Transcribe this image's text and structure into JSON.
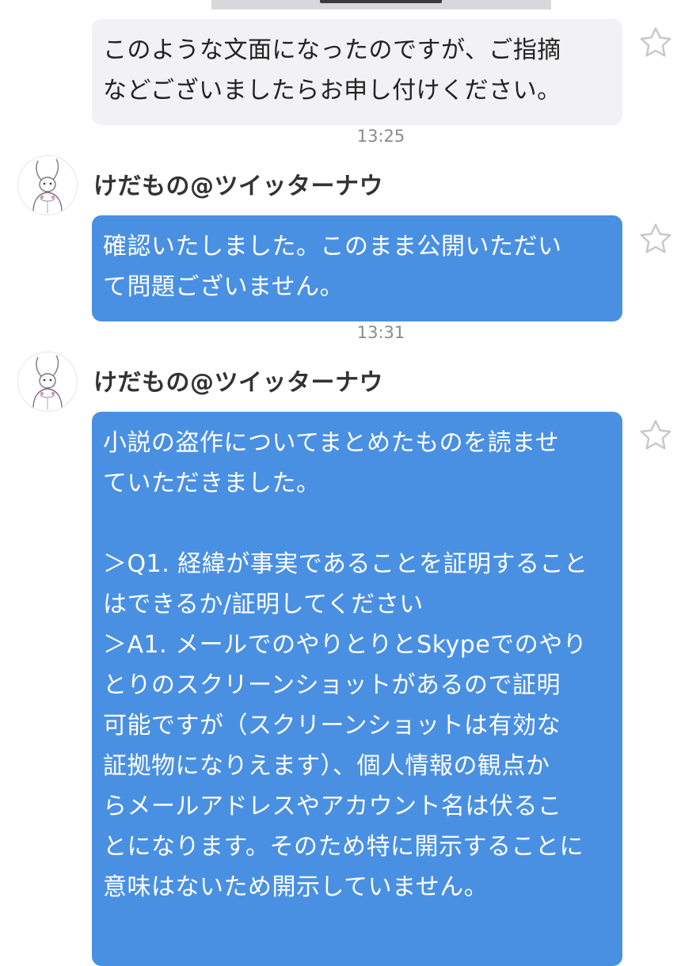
{
  "messages": [
    {
      "text": "このような文面になったのですが、ご指摘\nなどございましたらお申し付けください。"
    },
    {
      "timestamp": "13:25",
      "sender": "けだもの@ツイッターナウ",
      "text": "確認いたしました。このまま公開いただい\nて問題ございません。"
    },
    {
      "timestamp": "13:31",
      "sender": "けだもの@ツイッターナウ",
      "text": "小説の盗作についてまとめたものを読ませ\nていただきました。\n\n＞Q1. 経緯が事実であることを証明すること\nはできるか/証明してください\n＞A1. メールでのやりとりとSkypeでのやり\nとりのスクリーンショットがあるので証明\n可能ですが（スクリーンショットは有効な\n証拠物になりえます）、個人情報の観点か\nらメールアドレスやアカウント名は伏るこ\nとになります。そのため特に開示することに\n意味はないため開示していません。"
    }
  ],
  "icons": {
    "favorite": "star-outline-icon",
    "avatar": "rabbit-avatar-icon"
  },
  "colors": {
    "own_bubble": "#f2f2f4",
    "other_bubble": "#4a90e2",
    "timestamp": "#8a8a8e",
    "star": "#c8c8cc"
  }
}
